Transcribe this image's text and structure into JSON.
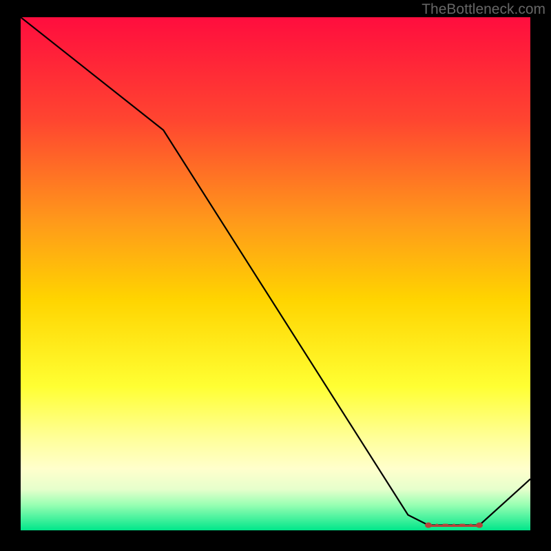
{
  "watermark": "TheBottleneck.com",
  "chart_data": {
    "type": "line",
    "title": "",
    "xlabel": "",
    "ylabel": "",
    "xlim": [
      0,
      100
    ],
    "ylim": [
      0,
      100
    ],
    "background_gradient": {
      "stops": [
        {
          "offset": 0,
          "color": "#ff0d3e"
        },
        {
          "offset": 20,
          "color": "#ff4530"
        },
        {
          "offset": 40,
          "color": "#ff9a1a"
        },
        {
          "offset": 55,
          "color": "#ffd400"
        },
        {
          "offset": 72,
          "color": "#ffff33"
        },
        {
          "offset": 82,
          "color": "#ffff99"
        },
        {
          "offset": 88,
          "color": "#ffffcc"
        },
        {
          "offset": 92,
          "color": "#e6ffcc"
        },
        {
          "offset": 95,
          "color": "#99ffb3"
        },
        {
          "offset": 100,
          "color": "#00e68a"
        }
      ]
    },
    "series": [
      {
        "name": "bottleneck-curve",
        "x": [
          0,
          28,
          76,
          80,
          90,
          100
        ],
        "values": [
          100,
          78,
          3,
          1,
          1,
          10
        ]
      }
    ],
    "markers": {
      "x_start": 80,
      "x_end": 90,
      "y": 1,
      "shape": "horizontal-band",
      "color": "#b5443a"
    }
  }
}
